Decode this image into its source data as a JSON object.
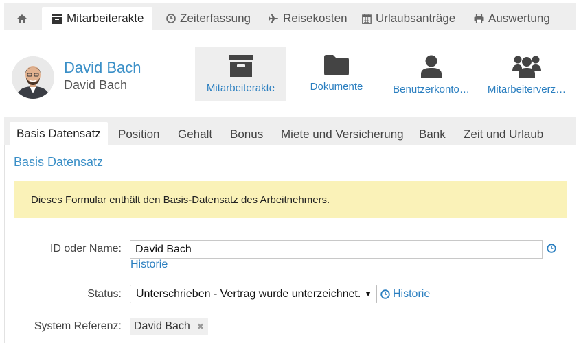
{
  "topnav": {
    "items": [
      {
        "label": "",
        "icon": "home-icon"
      },
      {
        "label": "Mitarbeiterakte",
        "icon": "archive-icon"
      },
      {
        "label": "Zeiterfassung",
        "icon": "clock-icon"
      },
      {
        "label": "Reisekosten",
        "icon": "plane-icon"
      },
      {
        "label": "Urlaubsanträge",
        "icon": "calendar-icon"
      },
      {
        "label": "Auswertung",
        "icon": "print-icon"
      }
    ],
    "active": "Mitarbeiterakte"
  },
  "header": {
    "name_primary": "David Bach",
    "name_secondary": "David Bach",
    "actions": [
      {
        "label": "Mitarbeiterakte",
        "icon": "archive-icon"
      },
      {
        "label": "Dokumente",
        "icon": "folder-icon"
      },
      {
        "label": "Benutzerkonto…",
        "icon": "user-icon"
      },
      {
        "label": "Mitarbeiterverz…",
        "icon": "users-icon"
      }
    ]
  },
  "subtabs": {
    "items": [
      "Basis Datensatz",
      "Position",
      "Gehalt",
      "Bonus",
      "Miete und Versicherung",
      "Bank",
      "Zeit und Urlaub"
    ],
    "active": "Basis Datensatz"
  },
  "form": {
    "title": "Basis Datensatz",
    "notice": "Dieses Formular enthält den Basis-Datensatz des Arbeitnehmers.",
    "id_label": "ID oder Name:",
    "id_value": "David Bach",
    "id_history": "Historie",
    "status_label": "Status:",
    "status_value": "Unterschrieben - Vertrag wurde unterzeichnet.",
    "status_history": "Historie",
    "ref_label": "System Referenz:",
    "ref_value": "David Bach"
  },
  "colors": {
    "accent": "#2b7fc0",
    "notice_bg": "#faf2b8",
    "tab_bg": "#eeeeee"
  }
}
